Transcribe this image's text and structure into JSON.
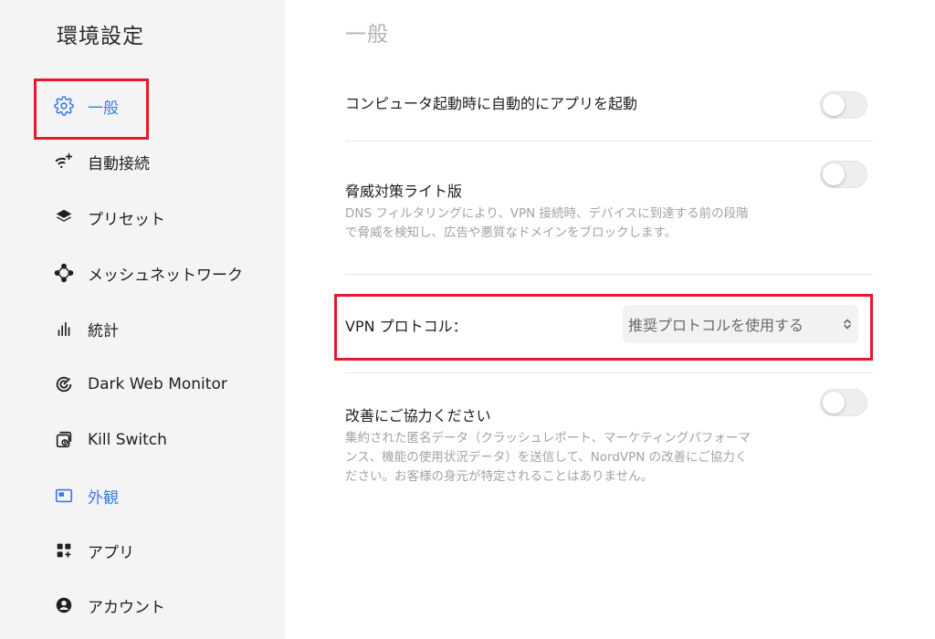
{
  "sidebar": {
    "title": "環境設定",
    "items": [
      {
        "label": "一般",
        "icon": "gear-icon"
      },
      {
        "label": "自動接続",
        "icon": "wifi-sparkle-icon"
      },
      {
        "label": "プリセット",
        "icon": "layers-icon"
      },
      {
        "label": "メッシュネットワーク",
        "icon": "mesh-network-icon"
      },
      {
        "label": "統計",
        "icon": "bar-chart-icon"
      },
      {
        "label": "Dark Web Monitor",
        "icon": "target-icon"
      },
      {
        "label": "Kill Switch",
        "icon": "kill-switch-icon"
      },
      {
        "label": "外観",
        "icon": "window-icon"
      },
      {
        "label": "アプリ",
        "icon": "apps-icon"
      },
      {
        "label": "アカウント",
        "icon": "account-icon"
      }
    ]
  },
  "main": {
    "title": "一般",
    "launch_on_startup": {
      "label": "コンピュータ起動時に自動的にアプリを起動",
      "enabled": false
    },
    "threat_protection": {
      "label": "脅威対策ライト版",
      "desc1": "DNS フィルタリングにより、VPN 接続時、デバイスに到達する前の段階",
      "desc2": "で脅威を検知し、広告や悪質なドメインをブロックします。",
      "enabled": false
    },
    "vpn_protocol": {
      "label": "VPN プロトコル：",
      "value": "推奨プロトコルを使用する"
    },
    "improve": {
      "label": "改善にご協力ください",
      "desc1": "集約された匿名データ（クラッシュレポート、マーケティングパフォーマ",
      "desc2": "ンス、機能の使用状況データ）を送信して、NordVPN の改善にご協力く",
      "desc3": "ださい。お客様の身元が特定されることはありません。",
      "enabled": false
    }
  },
  "colors": {
    "accent": "#3d7be6",
    "highlight": "#e8192c",
    "sidebar_bg": "#f4f4f4"
  }
}
